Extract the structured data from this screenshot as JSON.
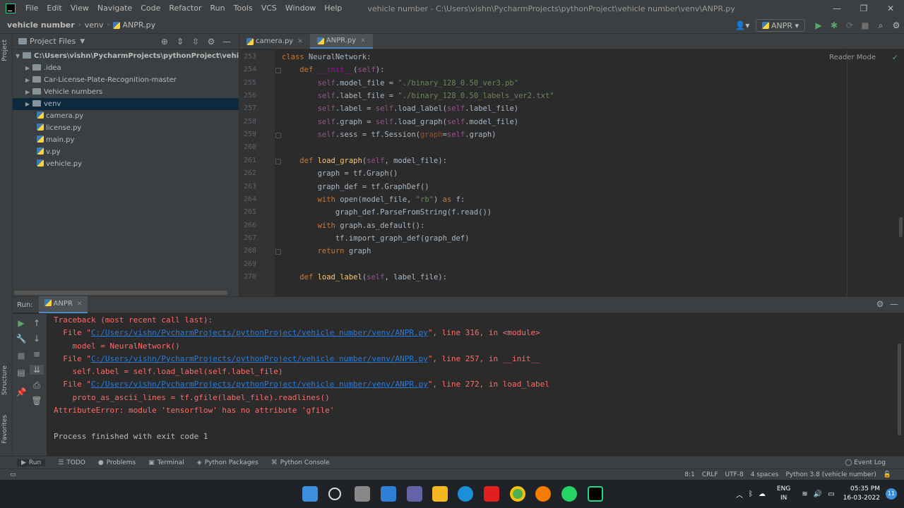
{
  "menu": [
    "File",
    "Edit",
    "View",
    "Navigate",
    "Code",
    "Refactor",
    "Run",
    "Tools",
    "VCS",
    "Window",
    "Help"
  ],
  "window_title": "vehicle number - C:\\Users\\vishn\\PycharmProjects\\pythonProject\\vehicle number\\venv\\ANPR.py",
  "breadcrumbs": [
    "vehicle number",
    "venv",
    "ANPR.py"
  ],
  "run_config": "ANPR",
  "left_strip": {
    "project": "Project",
    "structure": "Structure",
    "favorites": "Favorites"
  },
  "project_panel": {
    "title": "Project Files",
    "items": [
      {
        "label": "C:\\Users\\vishn\\PycharmProjects\\pythonProject\\vehicle numb",
        "type": "root"
      },
      {
        "label": ".idea",
        "type": "folder"
      },
      {
        "label": "Car-License-Plate-Recognition-master",
        "type": "folder"
      },
      {
        "label": "Vehicle numbers",
        "type": "folder"
      },
      {
        "label": "venv",
        "type": "folder",
        "selected": true
      },
      {
        "label": "camera.py",
        "type": "file"
      },
      {
        "label": "license.py",
        "type": "file"
      },
      {
        "label": "main.py",
        "type": "file"
      },
      {
        "label": "v.py",
        "type": "file"
      },
      {
        "label": "vehicle.py",
        "type": "file"
      }
    ]
  },
  "editor": {
    "tabs": [
      {
        "label": "camera.py",
        "active": false
      },
      {
        "label": "ANPR.py",
        "active": true
      }
    ],
    "reader_mode": "Reader Mode",
    "line_numbers": [
      "253",
      "254",
      "255",
      "256",
      "257",
      "258",
      "259",
      "260",
      "261",
      "262",
      "263",
      "264",
      "265",
      "266",
      "267",
      "268",
      "269",
      "270"
    ],
    "code": [
      "class NeuralNetwork:",
      "    def __init__(self):",
      "        self.model_file = \"./binary_128_0.50_ver3.pb\"",
      "        self.label_file = \"./binary_128_0.50_labels_ver2.txt\"",
      "        self.label = self.load_label(self.label_file)",
      "        self.graph = self.load_graph(self.model_file)",
      "        self.sess = tf.Session(graph=self.graph)",
      "",
      "    def load_graph(self, model_file):",
      "        graph = tf.Graph()",
      "        graph_def = tf.GraphDef()",
      "        with open(model_file, \"rb\") as f:",
      "            graph_def.ParseFromString(f.read())",
      "        with graph.as_default():",
      "            tf.import_graph_def(graph_def)",
      "        return graph",
      "",
      "    def load_label(self, label_file):"
    ]
  },
  "run_panel": {
    "label": "Run:",
    "tab": "ANPR",
    "console": {
      "l1": "Traceback (most recent call last):",
      "l2_pre": "  File \"",
      "path": "C:/Users/vishn/PycharmProjects/pythonProject/vehicle number/venv/ANPR.py",
      "l2_post": "\", line 316, in <module>",
      "l3": "    model = NeuralNetwork()",
      "l4_pre": "  File \"",
      "l4_post": "\", line 257, in __init__",
      "l5": "    self.label = self.load_label(self.label_file)",
      "l6_pre": "  File \"",
      "l6_post": "\", line 272, in load_label",
      "l7": "    proto_as_ascii_lines = tf.gfile(label_file).readlines()",
      "l8": "AttributeError: module 'tensorflow' has no attribute 'gfile'",
      "l9": "Process finished with exit code 1"
    }
  },
  "tool_tabs": [
    "Run",
    "TODO",
    "Problems",
    "Terminal",
    "Python Packages",
    "Python Console"
  ],
  "event_log": "Event Log",
  "status_bar": [
    "8:1",
    "CRLF",
    "UTF-8",
    "4 spaces",
    "Python 3.8 (vehicle number)"
  ],
  "taskbar": {
    "lang_top": "ENG",
    "lang_bottom": "IN",
    "time": "05:35 PM",
    "date": "16-03-2022",
    "notifications": "11"
  },
  "colors": {
    "error": "#ff6b68",
    "link": "#287bde",
    "keyword": "#cc7832",
    "string": "#6a8759",
    "self": "#94558d",
    "function": "#ffc66d"
  }
}
